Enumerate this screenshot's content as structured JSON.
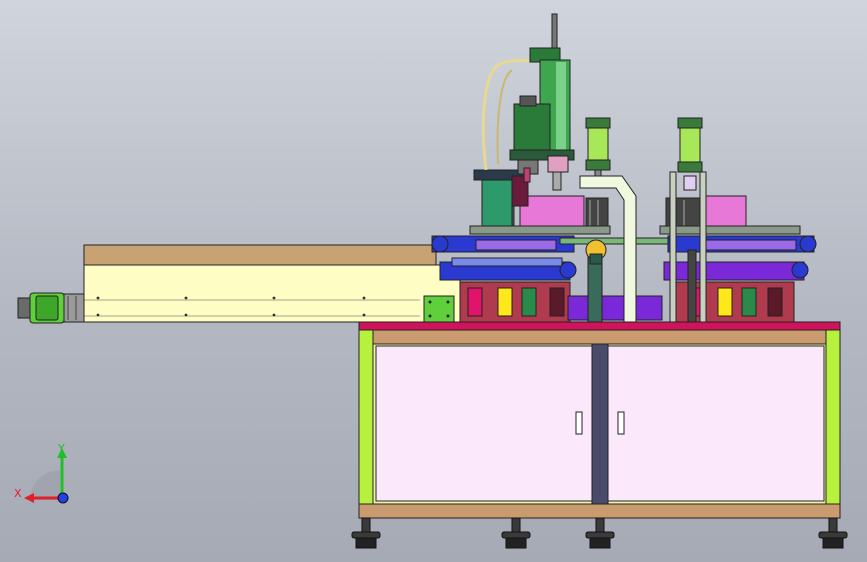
{
  "triad": {
    "x_label": "X",
    "y_label": "Y",
    "x_color": "#e0202a",
    "y_color": "#1fbf2c",
    "z_color": "#2140e8"
  },
  "colors": {
    "frame": "#f0f4a8",
    "cabinet_door": "#fbe8fa",
    "table_top": "#c99b6e",
    "table_stripe": "#d0145c",
    "arm_green": "#38a048",
    "slide_yellow": "#fdfdc4",
    "magenta_block": "#e878d8",
    "purple": "#8a2ce0",
    "blue": "#2a3ad0",
    "motor_green": "#5fcf3c"
  }
}
